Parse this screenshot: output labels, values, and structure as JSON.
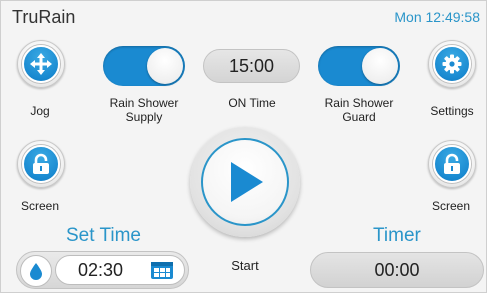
{
  "header": {
    "title": "TruRain",
    "clock": "Mon 12:49:58"
  },
  "controls": {
    "jog_label": "Jog",
    "rain_shower_supply_label": "Rain Shower\nSupply",
    "rain_shower_supply_on": true,
    "on_time_value": "15:00",
    "on_time_label": "ON Time",
    "rain_shower_guard_label": "Rain Shower\nGuard",
    "rain_shower_guard_on": true,
    "settings_label": "Settings",
    "screen_left_label": "Screen",
    "screen_right_label": "Screen",
    "start_label": "Start"
  },
  "set_time": {
    "title": "Set Time",
    "value": "02:30"
  },
  "timer": {
    "title": "Timer",
    "value": "00:00"
  },
  "icons": {
    "jog": "move-arrows-icon",
    "settings": "gear-icon",
    "screen_lock": "lock-icon",
    "start": "play-icon",
    "water": "water-drop-icon",
    "calendar": "calendar-icon"
  },
  "colors": {
    "accent": "#1a8ad1",
    "title_accent": "#2a95c9"
  }
}
